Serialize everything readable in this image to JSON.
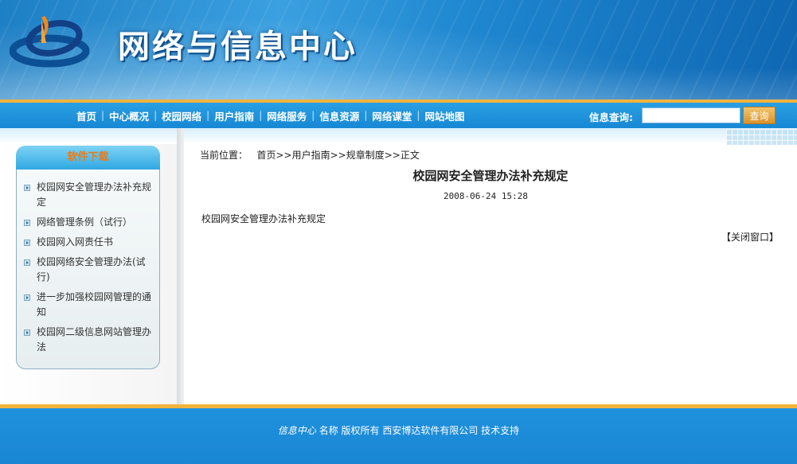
{
  "header": {
    "site_title": "网络与信息中心"
  },
  "nav": {
    "items": [
      "首页",
      "中心概况",
      "校园网络",
      "用户指南",
      "网络服务",
      "信息资源",
      "网络课堂",
      "网站地图"
    ],
    "search_label": "信息查询:",
    "search_value": "",
    "search_button": "查询"
  },
  "sidebar": {
    "heading": "软件下载",
    "items": [
      "校园网安全管理办法补充规定",
      "网络管理条例（试行）",
      "校园网入网责任书",
      "校园网络安全管理办法(试行)",
      "进一步加强校园网管理的通知",
      "校园网二级信息网站管理办法"
    ]
  },
  "main": {
    "breadcrumb_prefix": "当前位置：",
    "breadcrumb": [
      "首页",
      "用户指南",
      "规章制度",
      "正文"
    ],
    "breadcrumb_sep": ">>",
    "title": "校园网安全管理办法补充规定",
    "date": "2008-06-24 15:28",
    "body": "校园网安全管理办法补充规定",
    "close_link": "【关闭窗口】"
  },
  "footer": {
    "italic_part": "信息中心",
    "text": "名称 版权所有  西安博达软件有限公司 技术支持"
  },
  "colors": {
    "nav_blue": "#1688d4",
    "accent_orange": "#f2b33d",
    "sidebar_heading": "#ee7a12"
  }
}
